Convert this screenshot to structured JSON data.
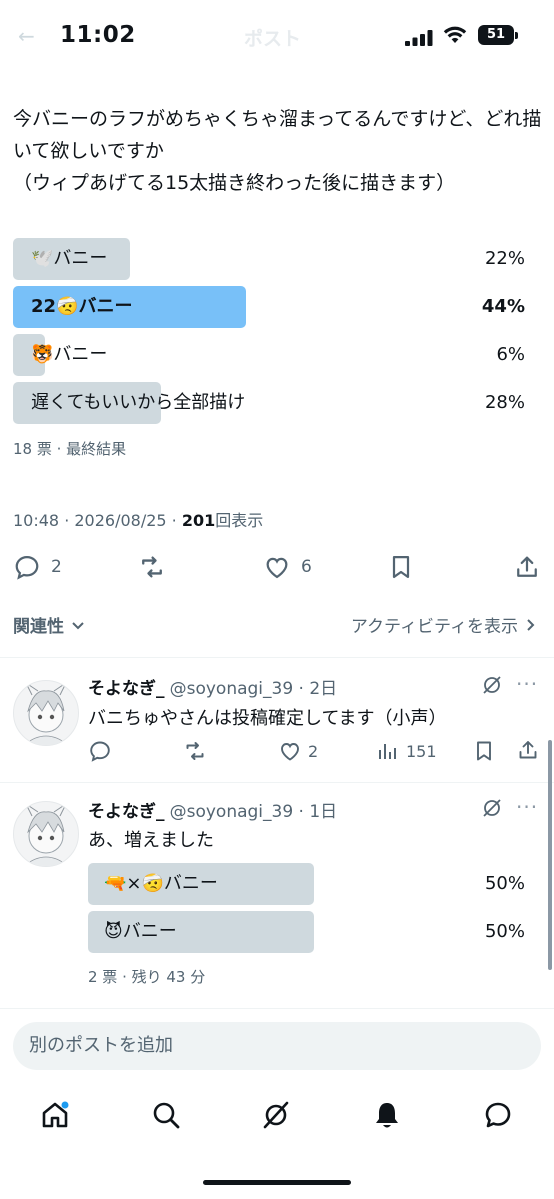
{
  "status_bar": {
    "time": "11:02",
    "battery": "51",
    "ghost_title": "ポスト"
  },
  "post": {
    "text": "今バニーのラフがめちゃくちゃ溜まってるんですけど、どれ描いて欲しいですか\n（ウィプあげてる15太描き終わった後に描きます）",
    "poll": [
      {
        "label": "🕊️バニー",
        "percent": "22%",
        "fraction": 0.22,
        "winner": false
      },
      {
        "label": "22🤕バニー",
        "percent": "44%",
        "fraction": 0.44,
        "winner": true
      },
      {
        "label": "🐯バニー",
        "percent": "6%",
        "fraction": 0.06,
        "winner": false
      },
      {
        "label": "遅くてもいいから全部描け",
        "percent": "28%",
        "fraction": 0.28,
        "winner": false
      }
    ],
    "poll_meta": "18 票 · 最終結果",
    "timestamp": "10:48 · 2026/08/25 · ",
    "views_count": "201",
    "views_label": "回表示",
    "replies": "2",
    "likes": "6"
  },
  "sort": {
    "label": "関連性",
    "activity": "アクティビティを表示"
  },
  "replies": [
    {
      "name": "そよなぎ_",
      "handle": "@soyonagi_39 · 2日",
      "text": "バニちゅやさんは投稿確定してます（小声）",
      "likes": "2",
      "views": "151"
    },
    {
      "name": "そよなぎ_",
      "handle": "@soyonagi_39 · 1日",
      "text": "あ、増えました",
      "poll": [
        {
          "label": "🔫×🤕バニー",
          "percent": "50%",
          "fraction": 0.5
        },
        {
          "label": "😈バニー",
          "percent": "50%",
          "fraction": 0.5
        }
      ],
      "poll_meta": "2 票 · 残り 43 分"
    }
  ],
  "compose": {
    "placeholder": "別のポストを追加"
  },
  "colors": {
    "accent_bar": "#78c0f8",
    "bar": "#cfd9de",
    "gray_text": "#536471",
    "notification_dot": "#1d9bf0"
  },
  "icons": [
    "back-icon",
    "signal-icon",
    "wifi-icon",
    "battery-icon",
    "reply-icon",
    "retweet-icon",
    "like-icon",
    "bookmark-icon",
    "share-icon",
    "chevron-down-icon",
    "chevron-right-icon",
    "grok-icon",
    "more-icon",
    "views-icon",
    "home-icon",
    "search-icon",
    "bell-icon",
    "messages-icon"
  ]
}
